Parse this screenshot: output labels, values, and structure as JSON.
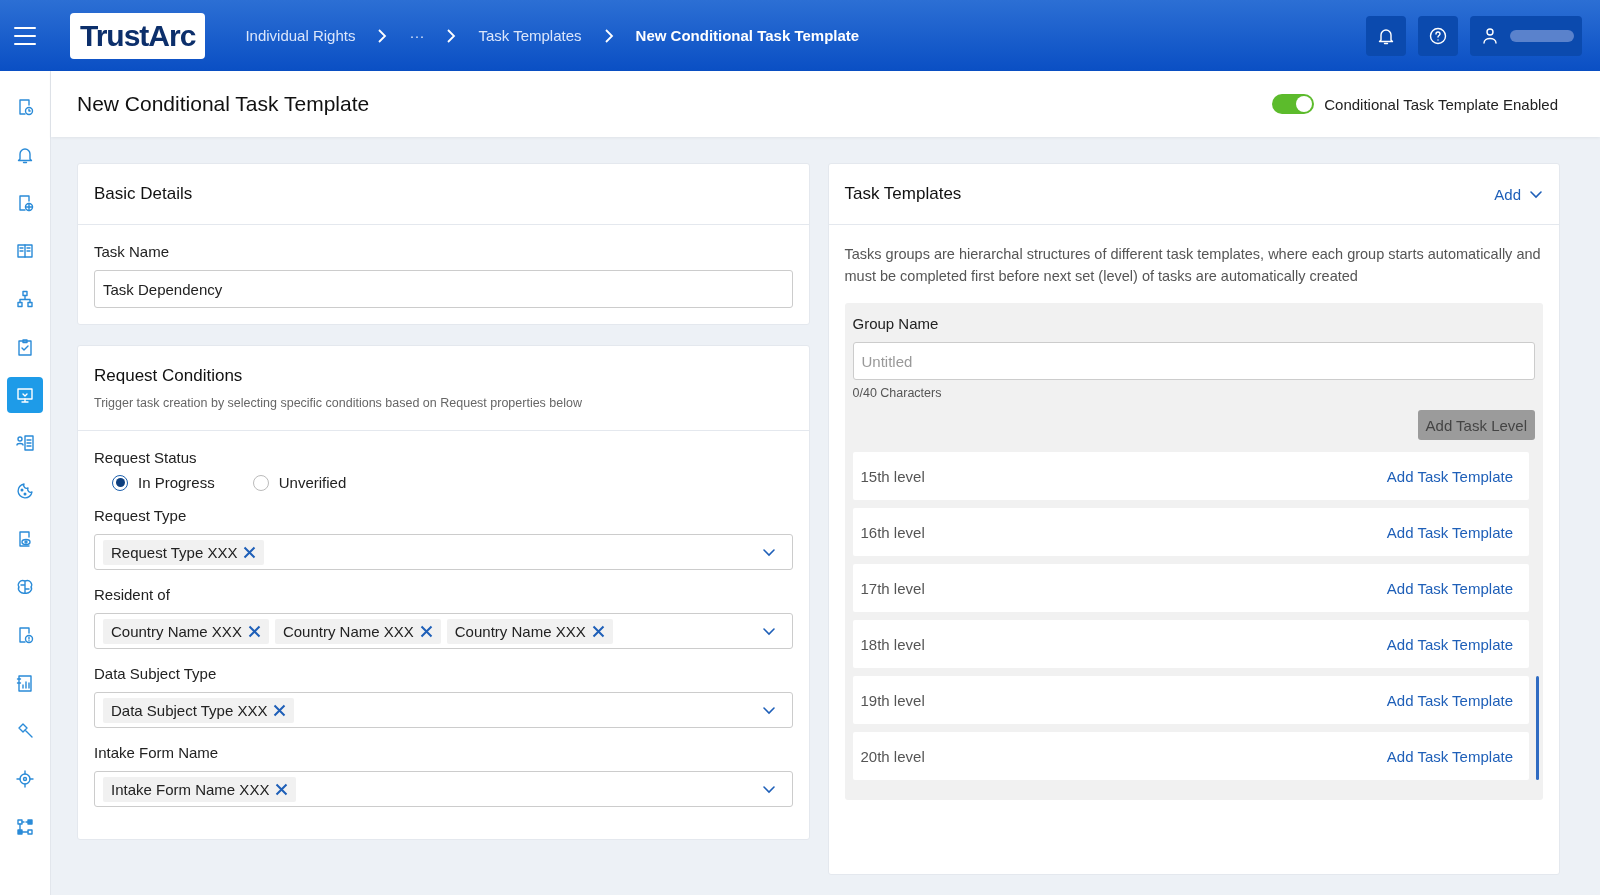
{
  "header": {
    "logo": "TrustArc",
    "breadcrumbs": [
      {
        "label": "Individual Rights",
        "current": false
      },
      {
        "label": "···",
        "current": false
      },
      {
        "label": "Task Templates",
        "current": false
      },
      {
        "label": "New Conditional Task Template",
        "current": true
      }
    ]
  },
  "sidebar": {
    "items": [
      {
        "selected": false
      },
      {
        "selected": false
      },
      {
        "selected": false
      },
      {
        "selected": false
      },
      {
        "selected": false
      },
      {
        "selected": false
      },
      {
        "selected": true
      },
      {
        "selected": false
      },
      {
        "selected": false
      },
      {
        "selected": false
      },
      {
        "selected": false
      },
      {
        "selected": false
      },
      {
        "selected": false
      },
      {
        "selected": false
      },
      {
        "selected": false
      },
      {
        "selected": false
      }
    ]
  },
  "page": {
    "title": "New Conditional Task Template",
    "toggle": {
      "label": "Conditional Task Template Enabled",
      "on": true
    }
  },
  "basic_details": {
    "title": "Basic Details",
    "task_name": {
      "label": "Task Name",
      "value": "Task Dependency"
    }
  },
  "request_conditions": {
    "title": "Request Conditions",
    "subtitle": "Trigger task creation by selecting specific conditions based on Request properties below",
    "status": {
      "label": "Request Status",
      "options": [
        {
          "label": "In Progress",
          "selected": true
        },
        {
          "label": "Unverified",
          "selected": false
        }
      ]
    },
    "fields": [
      {
        "label": "Request Type",
        "chips": [
          "Request Type XXX"
        ]
      },
      {
        "label": "Resident of",
        "chips": [
          "Country Name XXX",
          "Country Name XXX",
          "Country Name XXX"
        ]
      },
      {
        "label": "Data Subject Type",
        "chips": [
          "Data Subject Type XXX"
        ]
      },
      {
        "label": "Intake Form Name",
        "chips": [
          "Intake Form Name XXX"
        ]
      }
    ]
  },
  "task_templates": {
    "title": "Task Templates",
    "add": "Add",
    "description": "Tasks groups are hierarchal structures of different task templates, where each group starts automatically and must be completed first before next set (level) of tasks are automatically created",
    "group": {
      "label": "Group Name",
      "placeholder": "Untitled",
      "counter": "0/40 Characters",
      "add_level": "Add Task Level",
      "add_level_disabled": true
    },
    "levels": [
      {
        "name": "15th level",
        "action": "Add Task Template"
      },
      {
        "name": "16th level",
        "action": "Add Task Template"
      },
      {
        "name": "17th level",
        "action": "Add Task Template"
      },
      {
        "name": "18th level",
        "action": "Add Task Template"
      },
      {
        "name": "19th level",
        "action": "Add Task Template"
      },
      {
        "name": "20th level",
        "action": "Add Task Template"
      }
    ]
  }
}
